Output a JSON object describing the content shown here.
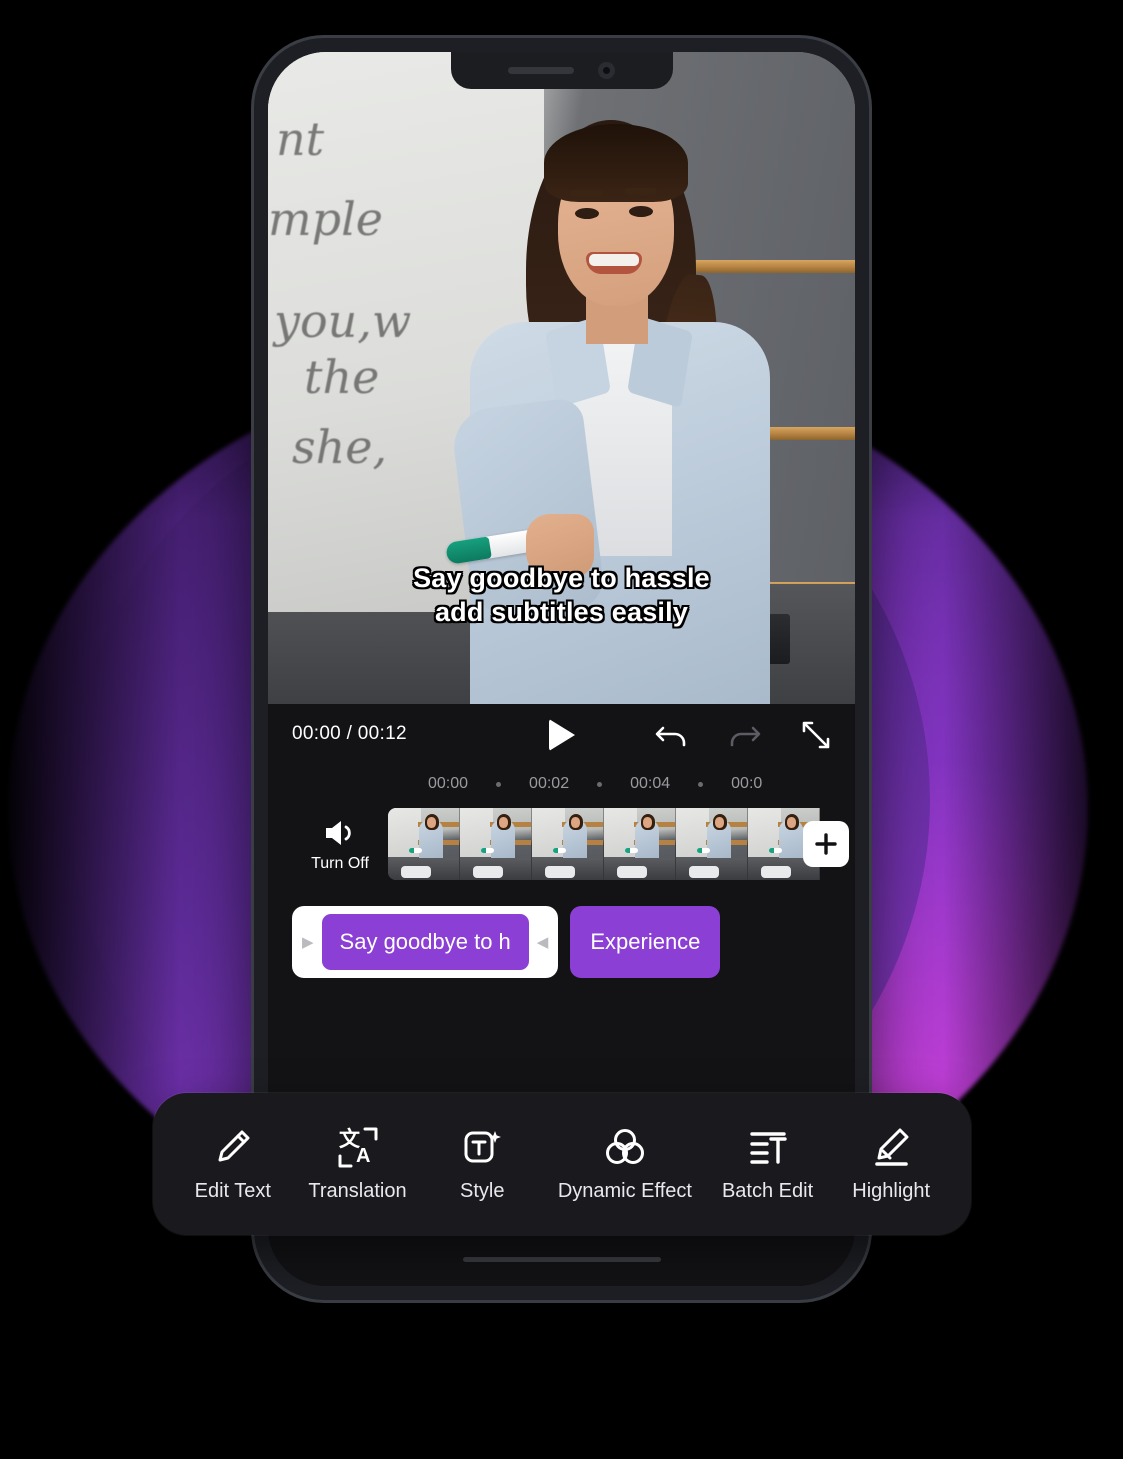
{
  "video": {
    "subtitle_line1": "Say goodbye to hassle",
    "subtitle_line2": "add subtitles easily",
    "scene_description": "woman at whiteboard holding marker"
  },
  "player": {
    "current_time": "00:00",
    "separator": "/",
    "total_time": "00:12",
    "time_display": "00:00 / 00:12",
    "play_icon": "play-icon",
    "undo_icon": "undo-icon",
    "redo_icon": "redo-icon",
    "fullscreen_icon": "fullscreen-expand-icon"
  },
  "timeline": {
    "ticks": [
      "00:00",
      "00:02",
      "00:04",
      "00:0"
    ],
    "audio": {
      "icon": "speaker-on-icon",
      "label": "Turn Off"
    },
    "add_clip_icon": "plus-icon",
    "frame_count": 6
  },
  "subtitle_track": {
    "selected_clip": "Say goodbye to h",
    "left_handle": "▶",
    "right_handle": "◀",
    "next_clip": "Experience"
  },
  "toolbar": {
    "items": [
      {
        "label": "Edit Text",
        "icon": "pencil-icon"
      },
      {
        "label": "Translation",
        "icon": "translate-icon"
      },
      {
        "label": "Style",
        "icon": "text-style-sparkle-icon"
      },
      {
        "label": "Dynamic Effect",
        "icon": "venn-circles-icon"
      },
      {
        "label": "Batch Edit",
        "icon": "batch-text-lines-icon"
      },
      {
        "label": "Highlight",
        "icon": "highlighter-marker-icon"
      }
    ]
  },
  "colors": {
    "accent_purple": "#8b3fd4",
    "panel_dark": "#131316",
    "toolbar_dark": "#1a1a1e",
    "background_magenta": "#c840d8"
  }
}
